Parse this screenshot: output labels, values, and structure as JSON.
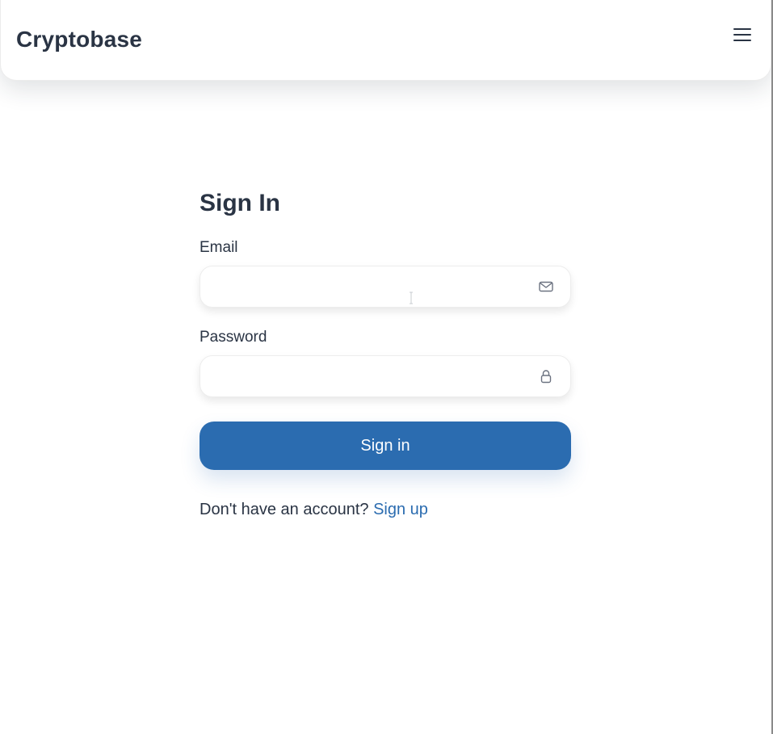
{
  "app": {
    "brand": "Cryptobase"
  },
  "header": {
    "menu_icon": "hamburger-menu-icon"
  },
  "signin": {
    "title": "Sign In",
    "email": {
      "label": "Email",
      "value": "",
      "placeholder": "",
      "icon": "envelope-icon"
    },
    "password": {
      "label": "Password",
      "value": "",
      "placeholder": "",
      "icon": "lock-icon"
    },
    "submit_label": "Sign in",
    "signup_prompt": "Don't have an account?",
    "signup_link": "Sign up"
  },
  "colors": {
    "primary": "#2b6cb0",
    "text": "#2a3444",
    "background": "#ffffff"
  }
}
